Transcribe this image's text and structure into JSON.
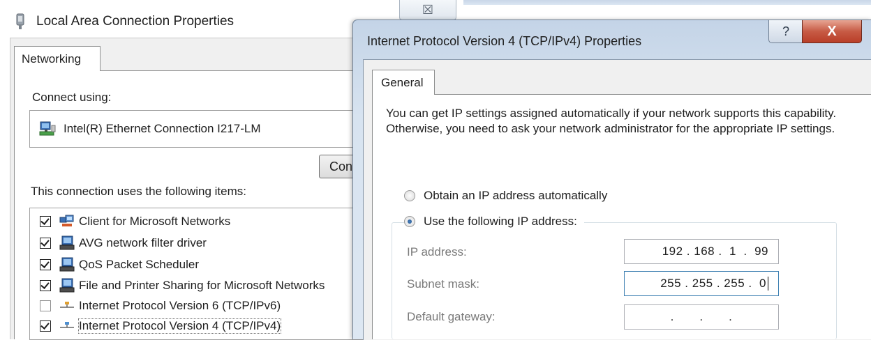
{
  "back_window": {
    "title": "Local Area Connection Properties",
    "close_glyph": "☒",
    "tab_label": "Networking",
    "connect_using_label": "Connect using:",
    "adapter_name": "Intel(R) Ethernet Connection I217-LM",
    "configure_label": "Configure...",
    "items_label": "This connection uses the following items:",
    "items": [
      {
        "label": "Client for Microsoft Networks",
        "checked": true,
        "icon": "network-client-icon"
      },
      {
        "label": "AVG network filter driver",
        "checked": true,
        "icon": "network-service-icon"
      },
      {
        "label": "QoS Packet Scheduler",
        "checked": true,
        "icon": "network-service-icon"
      },
      {
        "label": "File and Printer Sharing for Microsoft Networks",
        "checked": true,
        "icon": "network-service-icon"
      },
      {
        "label": "Internet Protocol Version 6 (TCP/IPv6)",
        "checked": false,
        "icon": "protocol-icon"
      },
      {
        "label": "Internet Protocol Version 4 (TCP/IPv4)",
        "checked": true,
        "icon": "protocol-icon",
        "selected": true
      }
    ]
  },
  "front_window": {
    "title": "Internet Protocol Version 4 (TCP/IPv4) Properties",
    "help_glyph": "?",
    "close_glyph": "X",
    "tab_label": "General",
    "intro_text": "You can get IP settings assigned automatically if your network supports this capability. Otherwise, you need to ask your network administrator for the appropriate IP settings.",
    "radio_auto": "Obtain an IP address automatically",
    "radio_manual": "Use the following IP address:",
    "selected_radio": "manual",
    "fields": {
      "ip_label": "IP address:",
      "ip_value": "192 . 168 .  1  .  99",
      "subnet_label": "Subnet mask:",
      "subnet_value": "255 . 255 . 255 .  0",
      "gateway_label": "Default gateway:",
      "gateway_value": " .       .       . "
    }
  },
  "colors": {
    "close_red": "#c75b45",
    "window_frame": "#d7e3f0",
    "selection_radio": "#1f4f87"
  }
}
